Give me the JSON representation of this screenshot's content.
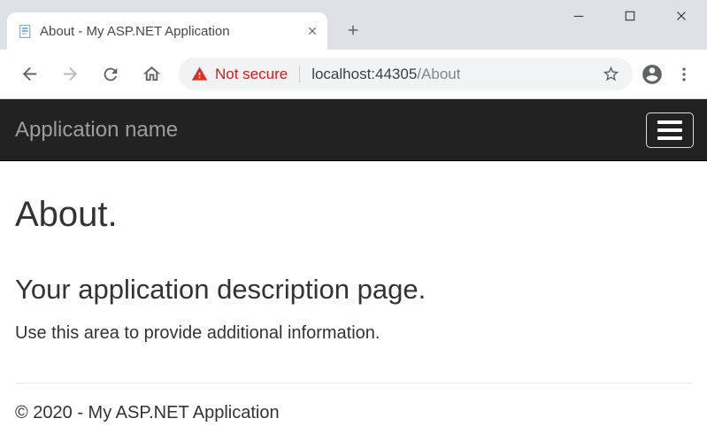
{
  "browser": {
    "tab_title": "About - My ASP.NET Application",
    "window_controls": {
      "minimize": "minimize",
      "maximize": "maximize",
      "close": "close"
    }
  },
  "omnibox": {
    "security_label": "Not secure",
    "url_host": "localhost:44305",
    "url_path": "/About"
  },
  "page": {
    "navbar_brand": "Application name",
    "heading": "About.",
    "subheading": "Your application description page.",
    "description": "Use this area to provide additional information.",
    "footer": "© 2020 - My ASP.NET Application"
  },
  "colors": {
    "tabstrip_bg": "#dee1e6",
    "omnibox_bg": "#f1f3f4",
    "accent_red": "#c5221f",
    "navbar_bg": "#222222",
    "brand_text": "#9d9d9d",
    "icon_gray": "#5f6368"
  }
}
